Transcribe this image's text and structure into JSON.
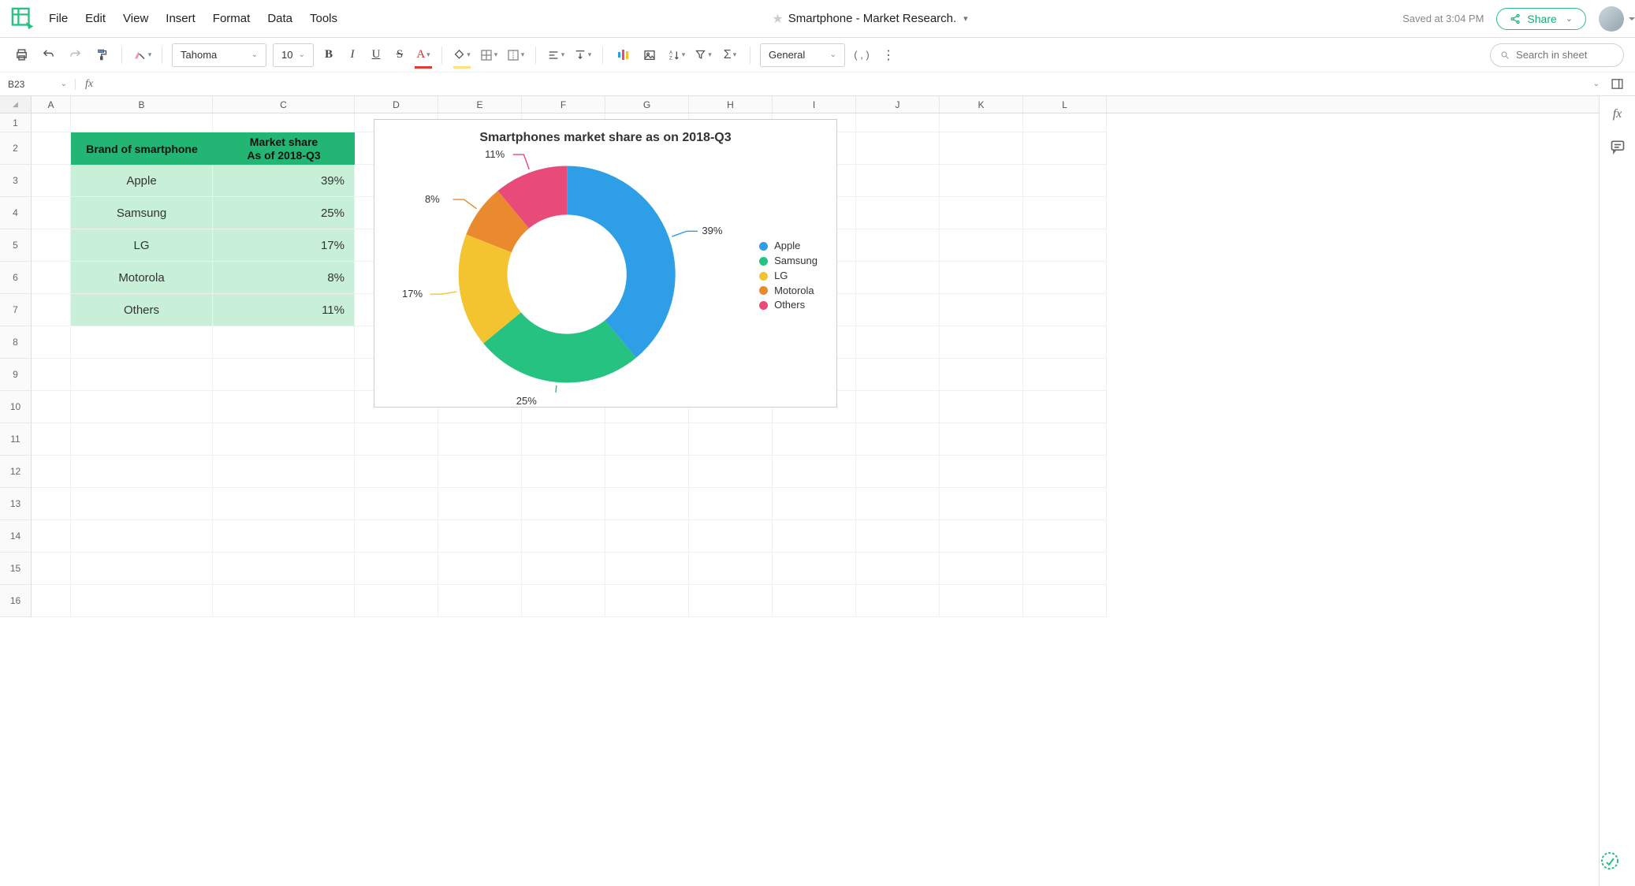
{
  "header": {
    "doc_title": "Smartphone - Market Research.",
    "saved_text": "Saved at 3:04 PM",
    "share_label": "Share"
  },
  "menu": [
    "File",
    "Edit",
    "View",
    "Insert",
    "Format",
    "Data",
    "Tools"
  ],
  "toolbar": {
    "font_family": "Tahoma",
    "font_size": "10",
    "number_format": "General",
    "search_placeholder": "Search in sheet"
  },
  "namebox": {
    "cell_ref": "B23"
  },
  "columns": [
    "A",
    "B",
    "C",
    "D",
    "E",
    "F",
    "G",
    "H",
    "I",
    "J",
    "K",
    "L"
  ],
  "rows": [
    "1",
    "2",
    "3",
    "4",
    "5",
    "6",
    "7",
    "8",
    "9",
    "10",
    "11",
    "12",
    "13",
    "14",
    "15",
    "16"
  ],
  "table": {
    "header_brand": "Brand of smartphone",
    "header_share_l1": "Market share",
    "header_share_l2": "As of 2018-Q3",
    "rows": [
      {
        "brand": "Apple",
        "share": "39%"
      },
      {
        "brand": "Samsung",
        "share": "25%"
      },
      {
        "brand": "LG",
        "share": "17%"
      },
      {
        "brand": "Motorola",
        "share": "8%"
      },
      {
        "brand": "Others",
        "share": "11%"
      }
    ]
  },
  "chart_title": "Smartphones market share as on 2018-Q3",
  "chart_data": {
    "type": "pie",
    "title": "Smartphones market share as on 2018-Q3",
    "categories": [
      "Apple",
      "Samsung",
      "LG",
      "Motorola",
      "Others"
    ],
    "values": [
      39,
      25,
      17,
      8,
      11
    ],
    "colors": [
      "#2e9fe6",
      "#26c281",
      "#f4c430",
      "#ea8a2e",
      "#e84a7a"
    ],
    "donut_inner_ratio": 0.55,
    "legend_position": "right",
    "data_labels": [
      "39%",
      "25%",
      "17%",
      "8%",
      "11%"
    ]
  }
}
